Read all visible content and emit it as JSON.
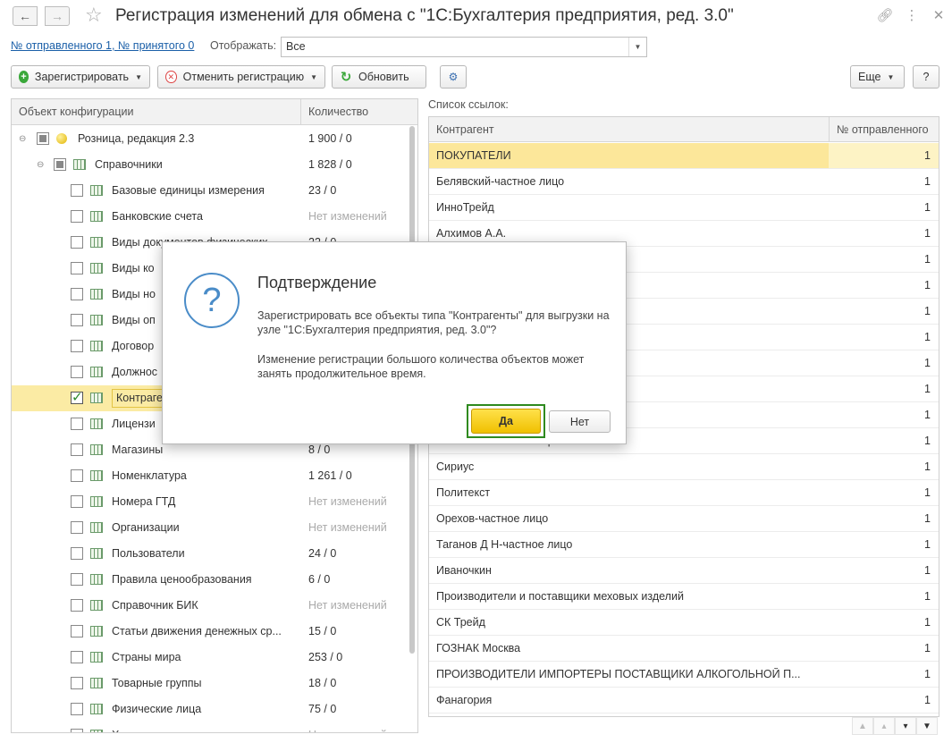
{
  "window": {
    "title": "Регистрация изменений для обмена с  \"1С:Бухгалтерия предприятия, ред. 3.0\"",
    "icons": [
      "back-icon",
      "forward-icon",
      "star-icon",
      "link-icon",
      "more-icon",
      "close-icon"
    ]
  },
  "header": {
    "link": "№ отправленного 1, № принятого 0",
    "show_label": "Отображать:",
    "show_value": "Все"
  },
  "toolbar": {
    "register": "Зарегистрировать",
    "cancel_registration": "Отменить регистрацию",
    "refresh": "Обновить",
    "more": "Еще",
    "help": "?"
  },
  "tree": {
    "col_object": "Объект конфигурации",
    "col_count": "Количество",
    "rows": [
      {
        "label": "Розница, редакция 2.3",
        "count": "1 900 / 0",
        "level": 0
      },
      {
        "label": "Справочники",
        "count": "1 828 / 0",
        "level": 1
      },
      {
        "label": "Базовые единицы измерения",
        "count": "23 / 0",
        "level": 2
      },
      {
        "label": "Банковские счета",
        "count": "Нет изменений",
        "level": 2
      },
      {
        "label": "Виды документов физических",
        "count": "22 / 0",
        "level": 2
      },
      {
        "label": "Виды ко",
        "count": "",
        "level": 2
      },
      {
        "label": "Виды но",
        "count": "",
        "level": 2
      },
      {
        "label": "Виды оп",
        "count": "",
        "level": 2
      },
      {
        "label": "Договор",
        "count": "",
        "level": 2
      },
      {
        "label": "Должнос",
        "count": "",
        "level": 2
      },
      {
        "label": "Контраге",
        "count": "",
        "level": 2
      },
      {
        "label": "Лицензи",
        "count": "",
        "level": 2
      },
      {
        "label": "Магазины",
        "count": "8 / 0",
        "level": 2
      },
      {
        "label": "Номенклатура",
        "count": "1 261 / 0",
        "level": 2
      },
      {
        "label": "Номера ГТД",
        "count": "Нет изменений",
        "level": 2
      },
      {
        "label": "Организации",
        "count": "Нет изменений",
        "level": 2
      },
      {
        "label": "Пользователи",
        "count": "24 / 0",
        "level": 2
      },
      {
        "label": "Правила ценообразования",
        "count": "6 / 0",
        "level": 2
      },
      {
        "label": "Справочник БИК",
        "count": "Нет изменений",
        "level": 2
      },
      {
        "label": "Статьи движения денежных ср...",
        "count": "15 / 0",
        "level": 2
      },
      {
        "label": "Страны мира",
        "count": "253 / 0",
        "level": 2
      },
      {
        "label": "Товарные группы",
        "count": "18 / 0",
        "level": 2
      },
      {
        "label": "Физические лица",
        "count": "75 / 0",
        "level": 2
      },
      {
        "label": "Характеристики номенклатуры",
        "count": "Нет изменений",
        "level": 2
      }
    ]
  },
  "refs": {
    "label": "Список ссылок:",
    "col_name": "Контрагент",
    "col_num": "№ отправленного",
    "rows": [
      {
        "name": "ПОКУПАТЕЛИ",
        "num": "1"
      },
      {
        "name": "Белявский-частное лицо",
        "num": "1"
      },
      {
        "name": "ИнноТрейд",
        "num": "1"
      },
      {
        "name": "Алхимов А.А.",
        "num": "1"
      },
      {
        "name": "",
        "num": "1"
      },
      {
        "name": "",
        "num": "1"
      },
      {
        "name": "",
        "num": "1"
      },
      {
        "name": "",
        "num": "1"
      },
      {
        "name": "",
        "num": "1"
      },
      {
        "name": "",
        "num": "1"
      },
      {
        "name": "",
        "num": "1"
      },
      {
        "name": "Алимова-частное лицо",
        "num": "1"
      },
      {
        "name": "Сириус",
        "num": "1"
      },
      {
        "name": "Политекст",
        "num": "1"
      },
      {
        "name": "Орехов-частное лицо",
        "num": "1"
      },
      {
        "name": "Таганов Д Н-частное лицо",
        "num": "1"
      },
      {
        "name": "Иваночкин",
        "num": "1"
      },
      {
        "name": "Производители и поставщики меховых изделий",
        "num": "1"
      },
      {
        "name": "СК Трейд",
        "num": "1"
      },
      {
        "name": "ГОЗНАК Москва",
        "num": "1"
      },
      {
        "name": "ПРОИЗВОДИТЕЛИ ИМПОРТЕРЫ ПОСТАВЩИКИ АЛКОГОЛЬНОЙ П...",
        "num": "1"
      },
      {
        "name": "Фанагория",
        "num": "1"
      }
    ]
  },
  "dialog": {
    "title": "Подтверждение",
    "message": "Зарегистрировать все объекты типа \"Контрагенты\" для выгрузки на узле \"1С:Бухгалтерия предприятия, ред. 3.0\"?",
    "message2": "Изменение регистрации большого количества объектов может занять продолжительное время.",
    "yes": "Да",
    "no": "Нет"
  },
  "colors": {
    "accent_yellow": "#f0c000",
    "selection": "#fce79a",
    "focus_green": "#2f8a1f",
    "link_blue": "#1a5fa8"
  }
}
